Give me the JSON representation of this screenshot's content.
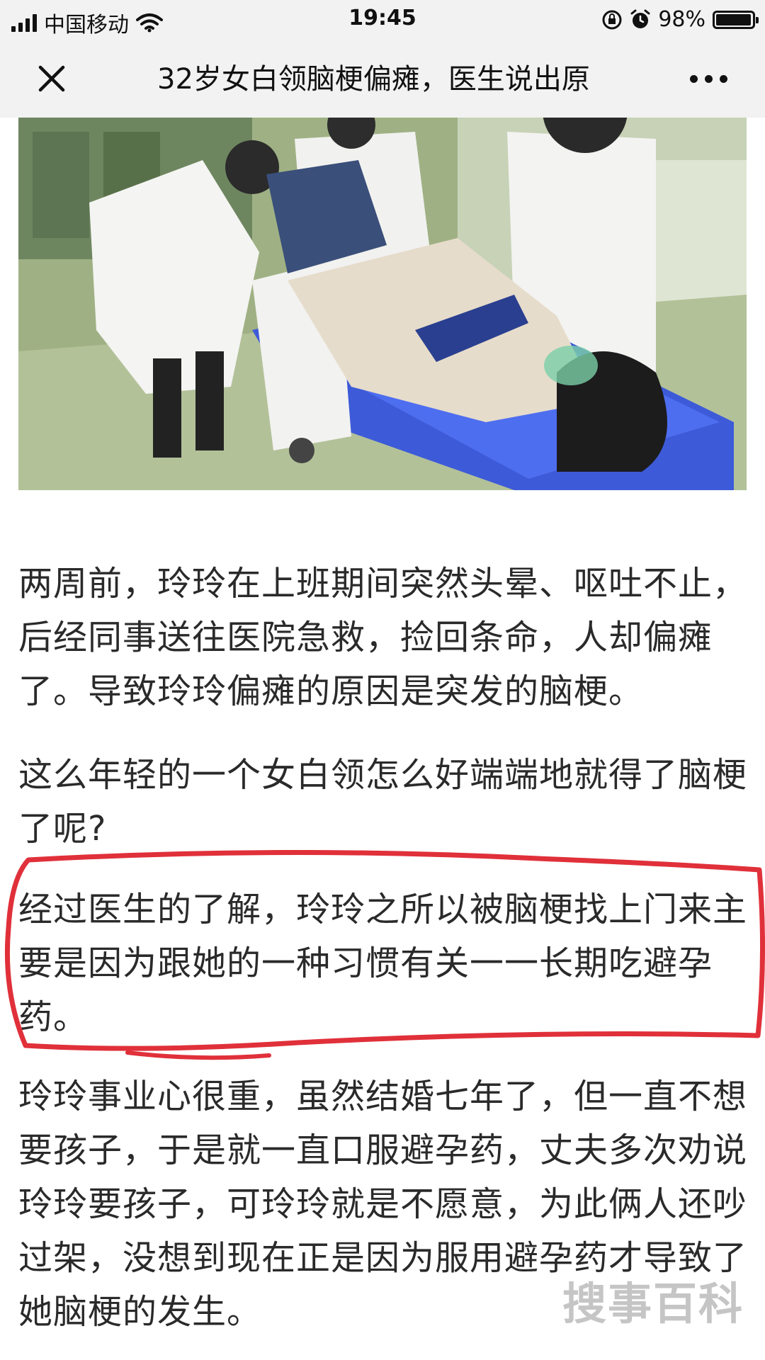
{
  "status_bar": {
    "carrier": "中国移动",
    "time": "19:45",
    "battery_percent": "98%",
    "battery_level": 0.98
  },
  "nav": {
    "title": "32岁女白领脑梗偏瘫，医生说出原"
  },
  "article": {
    "paragraph_1": "两周前，玲玲在上班期间突然头晕、呕吐不止，后经同事送往医院急救，捡回条命，人却偏瘫了。导致玲玲偏瘫的原因是突发的脑梗。",
    "paragraph_2": "这么年轻的一个女白领怎么好端端地就得了脑梗了呢?",
    "paragraph_3": "经过医生的了解，玲玲之所以被脑梗找上门来主要是因为跟她的一种习惯有关一一长期吃避孕药。",
    "paragraph_4": "玲玲事业心很重，虽然结婚七年了，但一直不想要孩子，于是就一直口服避孕药，丈夫多次劝说玲玲要孩子，可玲玲就是不愿意，为此俩人还吵过架，没想到现在正是因为服用避孕药才导致了她脑梗的发生。"
  },
  "watermark": "搜事百科",
  "colors": {
    "highlight": "#e0303a",
    "bar_background": "#f2f2f2"
  },
  "icons": {
    "signal": "signal-bars-icon",
    "wifi": "wifi-icon",
    "rotation_lock": "rotation-lock-icon",
    "alarm": "alarm-clock-icon",
    "battery": "battery-icon",
    "close": "close-icon",
    "more": "more-dots-icon"
  }
}
